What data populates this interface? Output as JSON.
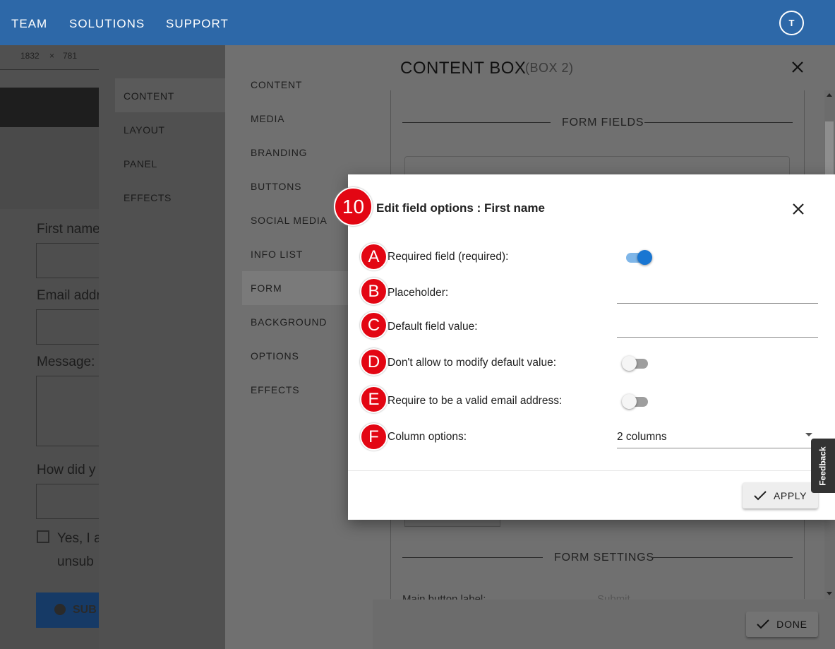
{
  "topnav": {
    "links": [
      "TEAM",
      "SOLUTIONS",
      "SUPPORT"
    ],
    "avatar_initial": "T"
  },
  "background_page": {
    "ruler_values": [
      "1832",
      "781"
    ],
    "fields": [
      "First name",
      "Email addr",
      "Message:",
      "How did y"
    ],
    "checkbox_text_line1": "Yes, I a",
    "checkbox_text_line2": "unsub",
    "submit_label": "SUB"
  },
  "left_menu": {
    "items": [
      "CONTENT",
      "LAYOUT",
      "PANEL",
      "EFFECTS"
    ],
    "active": "CONTENT"
  },
  "content_box": {
    "title": "CONTENT BOX",
    "subtitle": "(BOX 2)",
    "tabs": [
      "CONTENT",
      "MEDIA",
      "BRANDING",
      "BUTTONS",
      "SOCIAL MEDIA",
      "INFO LIST",
      "FORM",
      "BACKGROUND",
      "OPTIONS",
      "EFFECTS"
    ],
    "active_tab": "FORM",
    "form_fields_heading": "FORM FIELDS",
    "form_settings_heading": "FORM SETTINGS",
    "main_button_label": "Main button label:",
    "main_button_value": "Submit",
    "done_label": "DONE"
  },
  "dialog": {
    "step_badge": "10",
    "title": "Edit field options : First name",
    "rows": [
      {
        "badge": "A",
        "label": "Required field (required):",
        "control": "toggle",
        "value": true
      },
      {
        "badge": "B",
        "label": "Placeholder:",
        "control": "text",
        "value": ""
      },
      {
        "badge": "C",
        "label": "Default field value:",
        "control": "text",
        "value": ""
      },
      {
        "badge": "D",
        "label": "Don't allow to modify default value:",
        "control": "toggle",
        "value": false
      },
      {
        "badge": "E",
        "label": "Require to be a valid email address:",
        "control": "toggle",
        "value": false
      },
      {
        "badge": "F",
        "label": "Column options:",
        "control": "select",
        "value": "2 columns"
      }
    ],
    "apply_label": "APPLY"
  },
  "feedback_label": "Feedback",
  "colors": {
    "nav_blue": "#2d68a8",
    "badge_red": "#e30613",
    "toggle_on": "#1976d2"
  }
}
